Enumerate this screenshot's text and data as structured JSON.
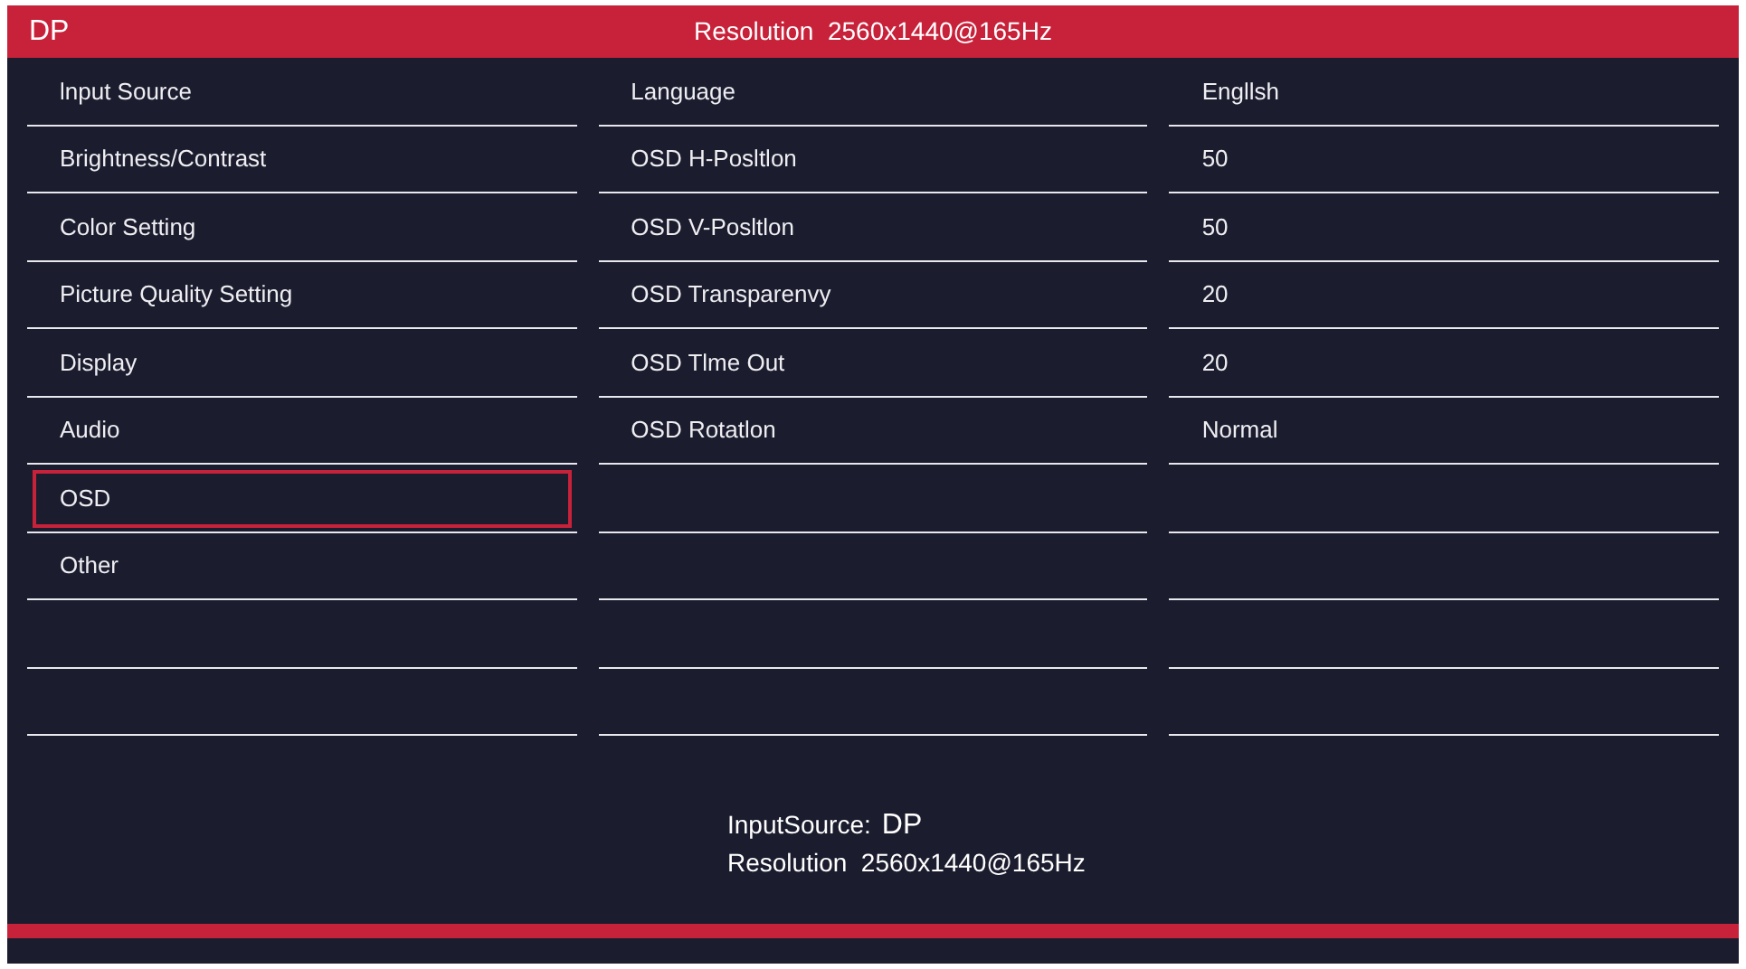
{
  "header": {
    "source": "DP",
    "resolution": "Resolution  2560x1440@165Hz"
  },
  "menu": [
    {
      "label": "lnput Source",
      "selected": false
    },
    {
      "label": "Brightness/Contrast",
      "selected": false
    },
    {
      "label": "Color Setting",
      "selected": false
    },
    {
      "label": "Picture Quality Setting",
      "selected": false
    },
    {
      "label": "Display",
      "selected": false
    },
    {
      "label": "Audio",
      "selected": false
    },
    {
      "label": "OSD",
      "selected": true
    },
    {
      "label": "Other",
      "selected": false
    }
  ],
  "settings": [
    {
      "label": "Language",
      "value": "Engllsh"
    },
    {
      "label": "OSD H-Posltlon",
      "value": "50"
    },
    {
      "label": "OSD V-Posltlon",
      "value": "50"
    },
    {
      "label": "OSD Transparenvy",
      "value": "20"
    },
    {
      "label": "OSD Tlme Out",
      "value": "20"
    },
    {
      "label": "OSD Rotatlon",
      "value": "Normal"
    }
  ],
  "footer": {
    "input_source_label": "InputSource:",
    "input_source_value": "DP",
    "resolution": "Resolution  2560x1440@165Hz"
  }
}
